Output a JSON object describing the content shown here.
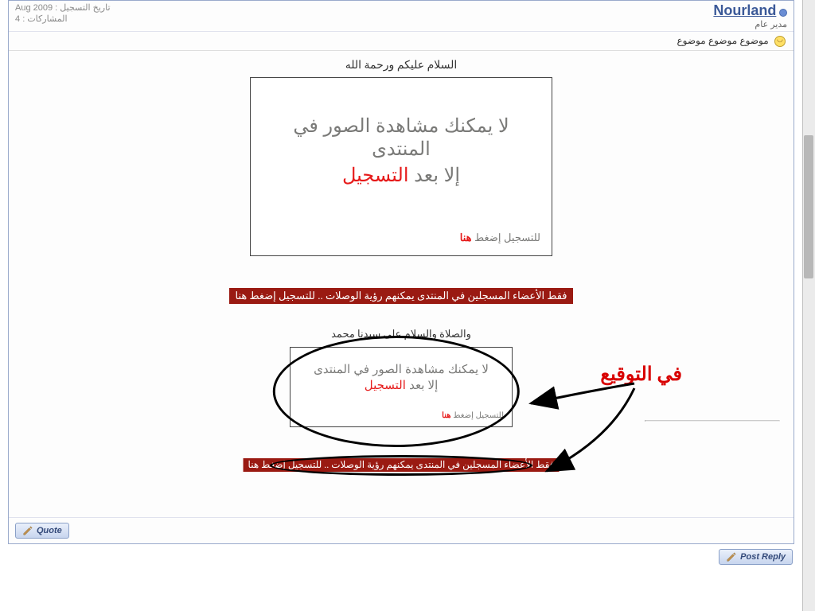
{
  "user": {
    "name": "Nourland",
    "title": "مدير عام",
    "join_label": "تاريخ التسجيل",
    "join_value": "Aug 2009",
    "posts_label": "المشاركات",
    "posts_value": "4"
  },
  "post_title": "موضوع موضوع موضوع",
  "greeting": "السلام عليكم ورحمة الله",
  "notice_line1": "لا يمكنك مشاهدة الصور في المنتدى",
  "notice_line2_a": "إلا بعد",
  "notice_line2_b": "التسجيل",
  "cta_small_a": "للتسجيل إضغط",
  "cta_small_b": "هنا",
  "red_bar_text": "فقط الأعضاء المسجلين في المنتدى يمكنهم رؤية الوصلات .. للتسجيل إضغط هنا",
  "closing": "والصلاة والسلام على سيدنا محمد",
  "annotation_label": "في التوقيع",
  "buttons": {
    "quote": "Quote",
    "post_reply": "Post Reply"
  }
}
